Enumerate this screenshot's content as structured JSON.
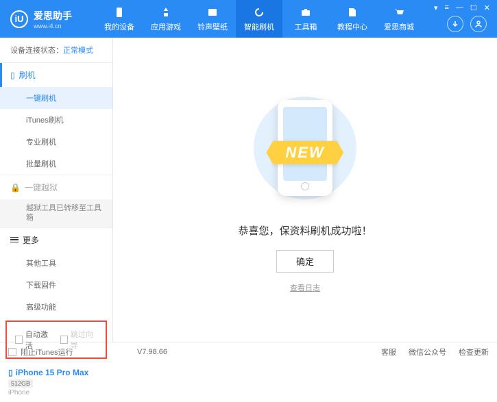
{
  "header": {
    "logo_letter": "iU",
    "app_name": "爱思助手",
    "url": "www.i4.cn",
    "nav": [
      {
        "label": "我的设备"
      },
      {
        "label": "应用游戏"
      },
      {
        "label": "铃声壁纸"
      },
      {
        "label": "智能刷机"
      },
      {
        "label": "工具箱"
      },
      {
        "label": "教程中心"
      },
      {
        "label": "爱思商城"
      }
    ]
  },
  "sidebar": {
    "conn_label": "设备连接状态：",
    "conn_mode": "正常模式",
    "sections": {
      "flash": {
        "title": "刷机",
        "items": [
          "一键刷机",
          "iTunes刷机",
          "专业刷机",
          "批量刷机"
        ]
      },
      "jailbreak": {
        "title": "一键越狱",
        "note": "越狱工具已转移至工具箱"
      },
      "more": {
        "title": "更多",
        "items": [
          "其他工具",
          "下载固件",
          "高级功能"
        ]
      }
    },
    "checkboxes": {
      "auto_activate": "自动激活",
      "skip_guide": "跳过向导"
    },
    "device": {
      "name": "iPhone 15 Pro Max",
      "storage": "512GB",
      "type": "iPhone"
    }
  },
  "content": {
    "banner": "NEW",
    "success": "恭喜您，保资料刷机成功啦！",
    "ok": "确定",
    "log": "查看日志"
  },
  "footer": {
    "block_itunes": "阻止iTunes运行",
    "version": "V7.98.66",
    "links": [
      "客服",
      "微信公众号",
      "检查更新"
    ]
  }
}
